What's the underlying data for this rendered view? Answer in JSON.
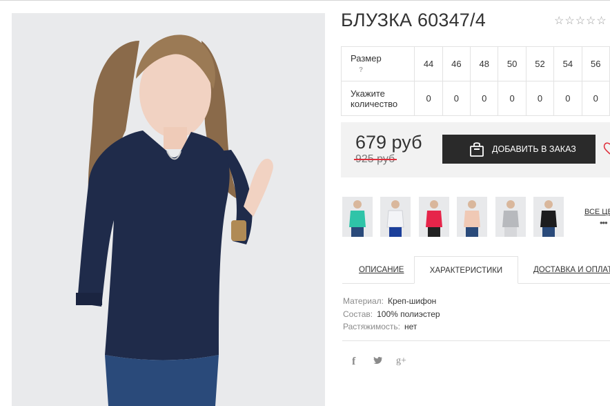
{
  "product": {
    "title": "БЛУЗКА 60347/4",
    "rating_stars": "☆☆☆☆☆"
  },
  "sizes": {
    "size_label": "Размер",
    "help_mark": "?",
    "qty_label_1": "Укажите",
    "qty_label_2": "количество",
    "values": [
      "44",
      "46",
      "48",
      "50",
      "52",
      "54",
      "56"
    ],
    "quantities": [
      "0",
      "0",
      "0",
      "0",
      "0",
      "0",
      "0"
    ]
  },
  "price": {
    "current": "679 руб",
    "old": "925 руб",
    "add_to_order_label": "ДОБАВИТЬ В ЗАКАЗ",
    "old_price_strike_color": "#e0303c"
  },
  "colors": {
    "all_colors_label": "ВСЕ ЦВ",
    "more_dots": "•••",
    "variants": [
      {
        "name": "mint",
        "hex": "#2fc4a8"
      },
      {
        "name": "white",
        "hex": "#e9eaee"
      },
      {
        "name": "red",
        "hex": "#e6254a"
      },
      {
        "name": "peach",
        "hex": "#f0c9b5"
      },
      {
        "name": "grey",
        "hex": "#b7b9bd"
      },
      {
        "name": "black",
        "hex": "#1c1c1e"
      }
    ]
  },
  "tabs": {
    "description": "ОПИСАНИЕ",
    "characteristics": "ХАРАКТЕРИСТИКИ",
    "delivery": "ДОСТАВКА И ОПЛАТА"
  },
  "specs": [
    {
      "key": "Материал:",
      "value": "Креп-шифон"
    },
    {
      "key": "Состав:",
      "value": "100% полиэстер"
    },
    {
      "key": "Растяжимость:",
      "value": "нет"
    }
  ],
  "social": {
    "facebook": "f",
    "twitter": "🐦",
    "google_plus": "g+"
  },
  "theme": {
    "button_bg": "#2a2a2a",
    "price_box_bg": "#f2f2f2",
    "blouse_color": "#1f2b4a"
  }
}
